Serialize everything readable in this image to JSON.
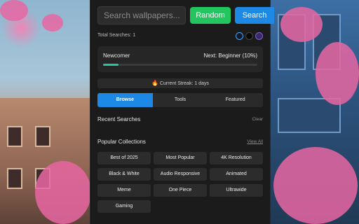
{
  "search": {
    "placeholder": "Search wallpapers...",
    "random_label": "Random",
    "search_label": "Search"
  },
  "stats": {
    "total_searches": "Total Searches: 1",
    "theme_swatches": [
      {
        "name": "blue",
        "color": "#3fa4ff"
      },
      {
        "name": "black",
        "color": "#0a0a0a"
      },
      {
        "name": "purple",
        "color": "#7d63c9"
      }
    ]
  },
  "level": {
    "current": "Newcomer",
    "next": "Next: Beginner (10%)",
    "progress_fraction": 0.1,
    "progress_color": "#26c6a2"
  },
  "streak": {
    "icon": "fire-icon",
    "text": "Current Streak: 1 days"
  },
  "tabs": [
    {
      "label": "Browse",
      "active": true
    },
    {
      "label": "Tools",
      "active": false
    },
    {
      "label": "Featured",
      "active": false
    }
  ],
  "recent": {
    "title": "Recent Searches",
    "action": "Clear"
  },
  "popular": {
    "title": "Popular Collections",
    "action": "View All",
    "items": [
      "Best of 2025",
      "Most Popular",
      "4K Resolution",
      "Black & White",
      "Audio Responsive",
      "Animated",
      "Meme",
      "One Piece",
      "Ultrawide",
      "Gaming"
    ]
  },
  "colors": {
    "accent_blue": "#1e88e5",
    "accent_green": "#22c55e",
    "panel_bg": "#1b1b1b"
  }
}
